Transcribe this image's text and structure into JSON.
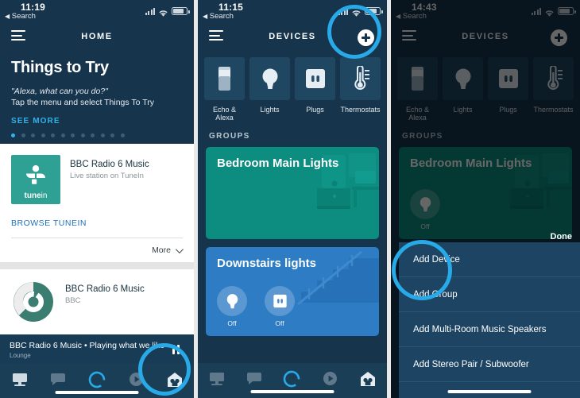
{
  "colors": {
    "navy": "#16344b",
    "navy_dark": "#12293c",
    "teal_card": "#0c8d80",
    "blue_card": "#2d7cc4",
    "accent_blue": "#28a9e8",
    "link_blue": "#31b3e8",
    "tunein_green": "#2fa094",
    "bbc_green": "#3c7d72",
    "sheet_bg": "#1d4563",
    "light_bg": "#ededed"
  },
  "panel1": {
    "status": {
      "time": "11:19",
      "back_label": "Search",
      "back_arrow": "◀"
    },
    "header": {
      "title": "HOME",
      "menu_icon": "hamburger-icon"
    },
    "hero": {
      "title": "Things to Try",
      "quote": "\"Alexa, what can you do?\"",
      "subtitle": "Tap the menu and select Things To Try",
      "see_more": "SEE MORE",
      "dot_count": 12,
      "active_dot": 0
    },
    "tunein_card": {
      "logo_text_1": "tune",
      "logo_text_2": "in",
      "title": "BBC Radio 6 Music",
      "subtitle": "Live station on TuneIn",
      "browse_link": "BROWSE TUNEIN",
      "more_label": "More"
    },
    "bbc_card": {
      "title": "BBC Radio 6 Music",
      "subtitle": "BBC"
    },
    "now_playing": {
      "line1": "BBC Radio 6 Music • Playing what we like",
      "line2": "Lounge",
      "control": "pause-icon"
    },
    "tabs": [
      {
        "name": "tab-home",
        "icon": "home-screen-icon"
      },
      {
        "name": "tab-communicate",
        "icon": "speech-bubble-icon"
      },
      {
        "name": "tab-alexa",
        "icon": "alexa-ring-icon"
      },
      {
        "name": "tab-play",
        "icon": "play-circle-icon"
      },
      {
        "name": "tab-devices",
        "icon": "devices-house-icon"
      }
    ]
  },
  "panel2": {
    "status": {
      "time": "11:15",
      "back_label": "Search",
      "back_arrow": "◀"
    },
    "header": {
      "title": "DEVICES",
      "menu_icon": "hamburger-icon",
      "add_icon": "plus-icon"
    },
    "device_types": [
      {
        "label": "Echo & Alexa",
        "icon": "echo-speaker-icon"
      },
      {
        "label": "Lights",
        "icon": "lightbulb-icon"
      },
      {
        "label": "Plugs",
        "icon": "outlet-plug-icon"
      },
      {
        "label": "Thermostats",
        "icon": "thermostat-icon"
      }
    ],
    "groups_label": "GROUPS",
    "groups": [
      {
        "title": "Bedroom Main Lights",
        "color": "#0c8d80",
        "artwork": "bedroom-illustration",
        "controls": []
      },
      {
        "title": "Downstairs lights",
        "color": "#2d7cc4",
        "artwork": "staircase-illustration",
        "controls": [
          {
            "icon": "lightbulb-icon",
            "state": "Off"
          },
          {
            "icon": "outlet-plug-icon",
            "state": "Off"
          }
        ]
      }
    ]
  },
  "panel3": {
    "status": {
      "time": "14:43",
      "back_label": "Search",
      "back_arrow": "◀"
    },
    "header": {
      "title": "DEVICES",
      "menu_icon": "hamburger-icon",
      "add_icon": "plus-icon"
    },
    "device_types": [
      {
        "label": "Echo & Alexa",
        "icon": "echo-speaker-icon"
      },
      {
        "label": "Lights",
        "icon": "lightbulb-icon"
      },
      {
        "label": "Plugs",
        "icon": "outlet-plug-icon"
      },
      {
        "label": "Thermostats",
        "icon": "thermostat-icon"
      }
    ],
    "groups_label": "GROUPS",
    "group": {
      "title": "Bedroom Main Lights",
      "control_state": "Off"
    },
    "done_label": "Done",
    "sheet_items": [
      "Add Device",
      "Add Group",
      "Add Multi-Room Music Speakers",
      "Add Stereo Pair / Subwoofer"
    ]
  },
  "annotations": [
    {
      "name": "devices-tab-highlight",
      "panel": 1
    },
    {
      "name": "add-device-plus-highlight",
      "panel": 2
    },
    {
      "name": "add-device-menu-highlight",
      "panel": 3
    }
  ]
}
